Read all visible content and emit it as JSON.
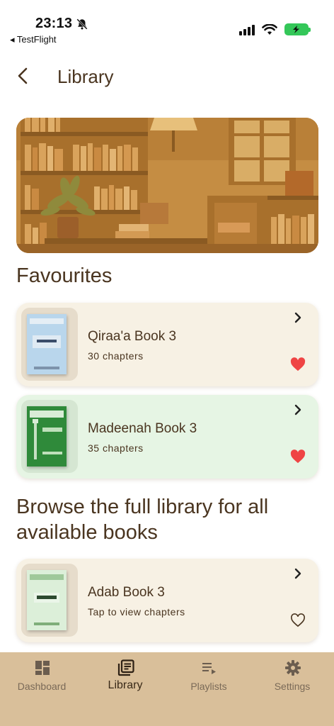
{
  "status_bar": {
    "time": "23:13",
    "back_app": "◂ TestFlight",
    "icons": [
      "bell-slash-icon",
      "signal-icon",
      "wifi-icon",
      "battery-charging-icon"
    ]
  },
  "header": {
    "title": "Library",
    "back_icon": "chevron-left-icon"
  },
  "favourites": {
    "title": "Favourites",
    "items": [
      {
        "title": "Qiraa'a Book 3",
        "subtitle": "30 chapters",
        "favourite": true,
        "background": "#f7f1e4",
        "cover_color": "#a7c9e4"
      },
      {
        "title": "Madeenah Book 3",
        "subtitle": "35 chapters",
        "favourite": true,
        "background": "#e6f5e4",
        "cover_color": "#2f8a3a"
      }
    ]
  },
  "browse": {
    "title": "Browse the full library for all available books",
    "items": [
      {
        "title": "Adab Book 3",
        "subtitle": "Tap to view chapters",
        "favourite": false,
        "background": "#f7f1e4",
        "cover_color": "#d7ecd4"
      }
    ]
  },
  "bottom_nav": {
    "items": [
      {
        "label": "Dashboard",
        "icon": "dashboard-icon",
        "active": false
      },
      {
        "label": "Library",
        "icon": "library-icon",
        "active": true
      },
      {
        "label": "Playlists",
        "icon": "playlist-icon",
        "active": false
      },
      {
        "label": "Settings",
        "icon": "gear-icon",
        "active": false
      }
    ]
  },
  "colors": {
    "text": "#4a3520",
    "heart": "#ef4444",
    "nav_bg": "#d9bf9a",
    "battery": "#34c759"
  }
}
